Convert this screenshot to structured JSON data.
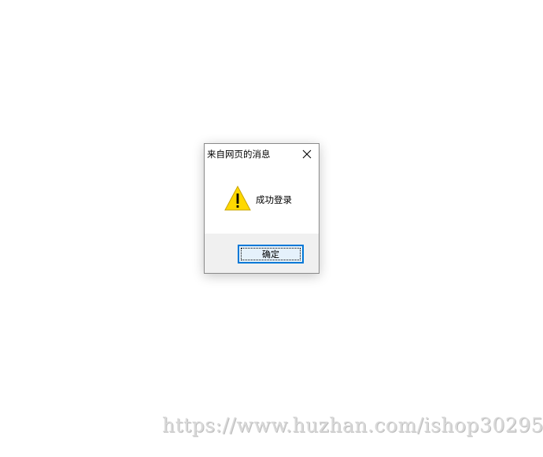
{
  "dialog": {
    "title": "来自网页的消息",
    "close_icon": "close-icon",
    "message": "成功登录",
    "message_icon": "warning-icon",
    "ok_label": "确定"
  },
  "watermark": {
    "text": "https://www.huzhan.com/ishop30295"
  },
  "colors": {
    "background": "#ffffff",
    "footer": "#f0f0f0",
    "button_border": "#0078d7",
    "button_fill": "#e5f1fb",
    "warning_fill": "#ffd800"
  }
}
